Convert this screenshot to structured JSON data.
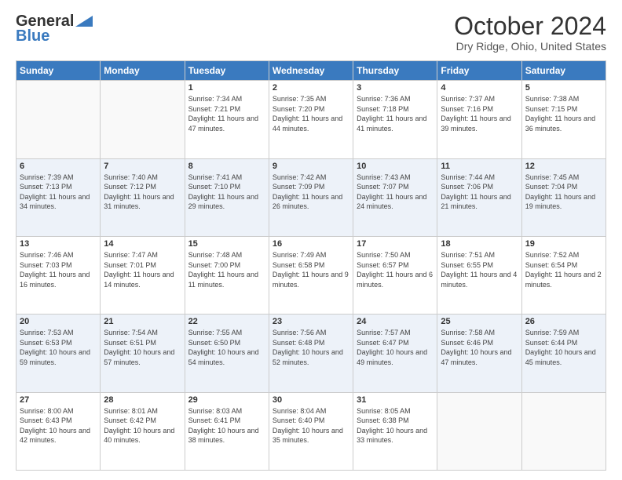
{
  "header": {
    "logo_general": "General",
    "logo_blue": "Blue",
    "title": "October 2024",
    "location": "Dry Ridge, Ohio, United States"
  },
  "days_of_week": [
    "Sunday",
    "Monday",
    "Tuesday",
    "Wednesday",
    "Thursday",
    "Friday",
    "Saturday"
  ],
  "weeks": [
    [
      {
        "day": "",
        "detail": ""
      },
      {
        "day": "",
        "detail": ""
      },
      {
        "day": "1",
        "detail": "Sunrise: 7:34 AM\nSunset: 7:21 PM\nDaylight: 11 hours and 47 minutes."
      },
      {
        "day": "2",
        "detail": "Sunrise: 7:35 AM\nSunset: 7:20 PM\nDaylight: 11 hours and 44 minutes."
      },
      {
        "day": "3",
        "detail": "Sunrise: 7:36 AM\nSunset: 7:18 PM\nDaylight: 11 hours and 41 minutes."
      },
      {
        "day": "4",
        "detail": "Sunrise: 7:37 AM\nSunset: 7:16 PM\nDaylight: 11 hours and 39 minutes."
      },
      {
        "day": "5",
        "detail": "Sunrise: 7:38 AM\nSunset: 7:15 PM\nDaylight: 11 hours and 36 minutes."
      }
    ],
    [
      {
        "day": "6",
        "detail": "Sunrise: 7:39 AM\nSunset: 7:13 PM\nDaylight: 11 hours and 34 minutes."
      },
      {
        "day": "7",
        "detail": "Sunrise: 7:40 AM\nSunset: 7:12 PM\nDaylight: 11 hours and 31 minutes."
      },
      {
        "day": "8",
        "detail": "Sunrise: 7:41 AM\nSunset: 7:10 PM\nDaylight: 11 hours and 29 minutes."
      },
      {
        "day": "9",
        "detail": "Sunrise: 7:42 AM\nSunset: 7:09 PM\nDaylight: 11 hours and 26 minutes."
      },
      {
        "day": "10",
        "detail": "Sunrise: 7:43 AM\nSunset: 7:07 PM\nDaylight: 11 hours and 24 minutes."
      },
      {
        "day": "11",
        "detail": "Sunrise: 7:44 AM\nSunset: 7:06 PM\nDaylight: 11 hours and 21 minutes."
      },
      {
        "day": "12",
        "detail": "Sunrise: 7:45 AM\nSunset: 7:04 PM\nDaylight: 11 hours and 19 minutes."
      }
    ],
    [
      {
        "day": "13",
        "detail": "Sunrise: 7:46 AM\nSunset: 7:03 PM\nDaylight: 11 hours and 16 minutes."
      },
      {
        "day": "14",
        "detail": "Sunrise: 7:47 AM\nSunset: 7:01 PM\nDaylight: 11 hours and 14 minutes."
      },
      {
        "day": "15",
        "detail": "Sunrise: 7:48 AM\nSunset: 7:00 PM\nDaylight: 11 hours and 11 minutes."
      },
      {
        "day": "16",
        "detail": "Sunrise: 7:49 AM\nSunset: 6:58 PM\nDaylight: 11 hours and 9 minutes."
      },
      {
        "day": "17",
        "detail": "Sunrise: 7:50 AM\nSunset: 6:57 PM\nDaylight: 11 hours and 6 minutes."
      },
      {
        "day": "18",
        "detail": "Sunrise: 7:51 AM\nSunset: 6:55 PM\nDaylight: 11 hours and 4 minutes."
      },
      {
        "day": "19",
        "detail": "Sunrise: 7:52 AM\nSunset: 6:54 PM\nDaylight: 11 hours and 2 minutes."
      }
    ],
    [
      {
        "day": "20",
        "detail": "Sunrise: 7:53 AM\nSunset: 6:53 PM\nDaylight: 10 hours and 59 minutes."
      },
      {
        "day": "21",
        "detail": "Sunrise: 7:54 AM\nSunset: 6:51 PM\nDaylight: 10 hours and 57 minutes."
      },
      {
        "day": "22",
        "detail": "Sunrise: 7:55 AM\nSunset: 6:50 PM\nDaylight: 10 hours and 54 minutes."
      },
      {
        "day": "23",
        "detail": "Sunrise: 7:56 AM\nSunset: 6:48 PM\nDaylight: 10 hours and 52 minutes."
      },
      {
        "day": "24",
        "detail": "Sunrise: 7:57 AM\nSunset: 6:47 PM\nDaylight: 10 hours and 49 minutes."
      },
      {
        "day": "25",
        "detail": "Sunrise: 7:58 AM\nSunset: 6:46 PM\nDaylight: 10 hours and 47 minutes."
      },
      {
        "day": "26",
        "detail": "Sunrise: 7:59 AM\nSunset: 6:44 PM\nDaylight: 10 hours and 45 minutes."
      }
    ],
    [
      {
        "day": "27",
        "detail": "Sunrise: 8:00 AM\nSunset: 6:43 PM\nDaylight: 10 hours and 42 minutes."
      },
      {
        "day": "28",
        "detail": "Sunrise: 8:01 AM\nSunset: 6:42 PM\nDaylight: 10 hours and 40 minutes."
      },
      {
        "day": "29",
        "detail": "Sunrise: 8:03 AM\nSunset: 6:41 PM\nDaylight: 10 hours and 38 minutes."
      },
      {
        "day": "30",
        "detail": "Sunrise: 8:04 AM\nSunset: 6:40 PM\nDaylight: 10 hours and 35 minutes."
      },
      {
        "day": "31",
        "detail": "Sunrise: 8:05 AM\nSunset: 6:38 PM\nDaylight: 10 hours and 33 minutes."
      },
      {
        "day": "",
        "detail": ""
      },
      {
        "day": "",
        "detail": ""
      }
    ]
  ]
}
